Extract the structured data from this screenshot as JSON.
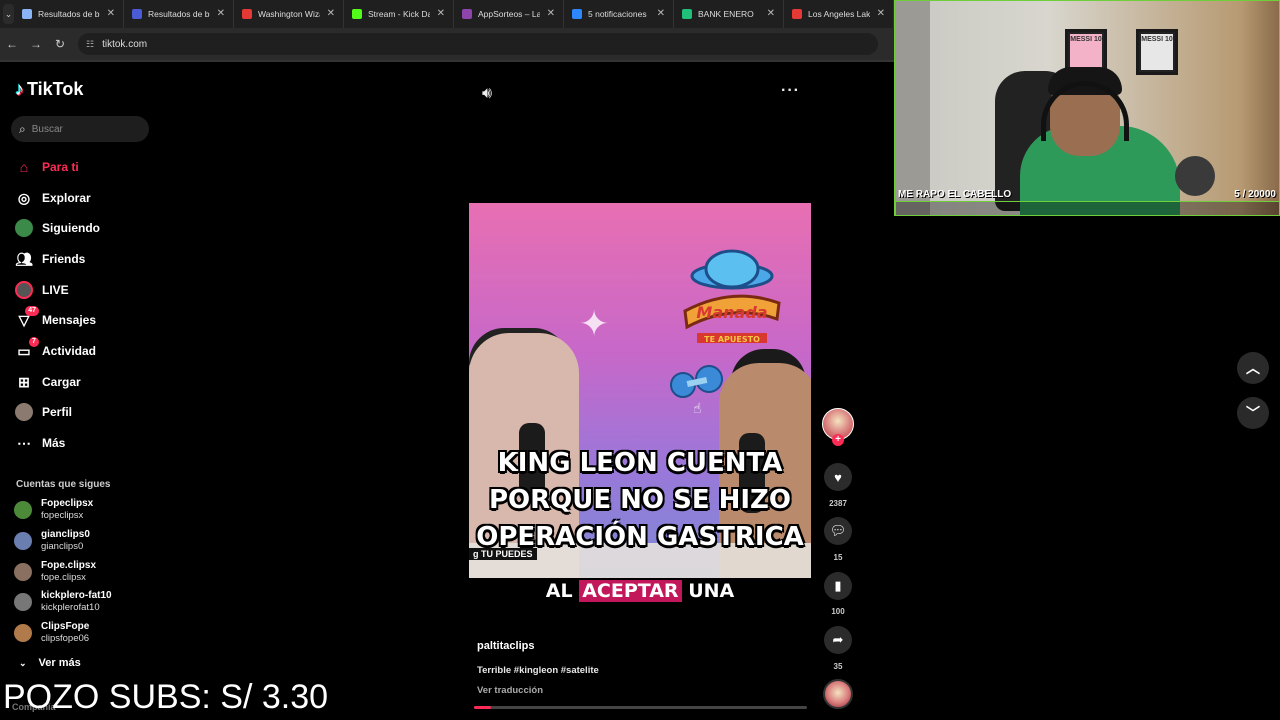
{
  "browser": {
    "tabs": [
      {
        "label": "Resultados de búsqueda",
        "color": "#8ab4f8"
      },
      {
        "label": "Resultados de búsqueda",
        "color": "#4a5bd6"
      },
      {
        "label": "Washington Wizards",
        "color": "#e53935"
      },
      {
        "label": "Stream - Kick Dashboard",
        "color": "#53fc18"
      },
      {
        "label": "AppSorteos – La mejor",
        "color": "#8e44ad"
      },
      {
        "label": "5 notificaciones",
        "color": "#2d88ff"
      },
      {
        "label": "BANK ENERO",
        "color": "#21c07a"
      },
      {
        "label": "Los Angeles Lakers",
        "color": "#e53935"
      }
    ],
    "url": "tiktok.com"
  },
  "sidebar": {
    "logo": "TikTok",
    "search_placeholder": "Buscar",
    "nav": [
      {
        "label": "Para ti",
        "icon": "home-icon",
        "active": true
      },
      {
        "label": "Explorar",
        "icon": "compass-icon"
      },
      {
        "label": "Siguiendo",
        "icon": "following-avatar-icon"
      },
      {
        "label": "Friends",
        "icon": "friends-icon"
      },
      {
        "label": "LIVE",
        "icon": "live-icon"
      },
      {
        "label": "Mensajes",
        "icon": "messages-icon",
        "badge": "47"
      },
      {
        "label": "Actividad",
        "icon": "activity-icon",
        "badge": "7"
      },
      {
        "label": "Cargar",
        "icon": "upload-icon"
      },
      {
        "label": "Perfil",
        "icon": "profile-avatar-icon"
      },
      {
        "label": "Más",
        "icon": "more-icon"
      }
    ],
    "following_title": "Cuentas que sigues",
    "accounts": [
      {
        "name": "Fopeclipsx",
        "handle": "fopeclipsx",
        "color": "#4c8a3a"
      },
      {
        "name": "gianclips0",
        "handle": "gianclips0",
        "color": "#6a7fb0"
      },
      {
        "name": "Fope.clipsx",
        "handle": "fope.clipsx",
        "color": "#8a7060"
      },
      {
        "name": "kickplero-fat10",
        "handle": "kickplerofat10",
        "color": "#777777"
      },
      {
        "name": "ClipsFope",
        "handle": "clipsfope06",
        "color": "#b07a4a"
      }
    ],
    "see_more": "Ver más",
    "company": "Compañía"
  },
  "overlay": {
    "pozo": "POZO SUBS: S/ 3.30"
  },
  "video": {
    "ticker": "g TU PUEDES",
    "headline": [
      "KING LEON CUENTA",
      "PORQUE NO SE HIZO",
      "OPERACIÓN GASTRICA"
    ],
    "subtitle": {
      "pre": "AL",
      "highlight": "ACEPTAR",
      "post": "UNA"
    },
    "author": "paltitaclips",
    "description": "Terrible #kingleon #satelite",
    "translate": "Ver traducción",
    "progress": 0.05
  },
  "actions": {
    "likes": "2387",
    "comments": "15",
    "saves": "100",
    "shares": "35"
  },
  "webcam": {
    "caption": "ME RAPO EL CABELLO",
    "goal": "5   / 20000",
    "goal_progress": 0.00025,
    "jersey1": "MESSI 10",
    "jersey2": "MESSI 10"
  },
  "colors": {
    "accent": "#fe2c55",
    "cam_border": "#6fcf3a"
  }
}
